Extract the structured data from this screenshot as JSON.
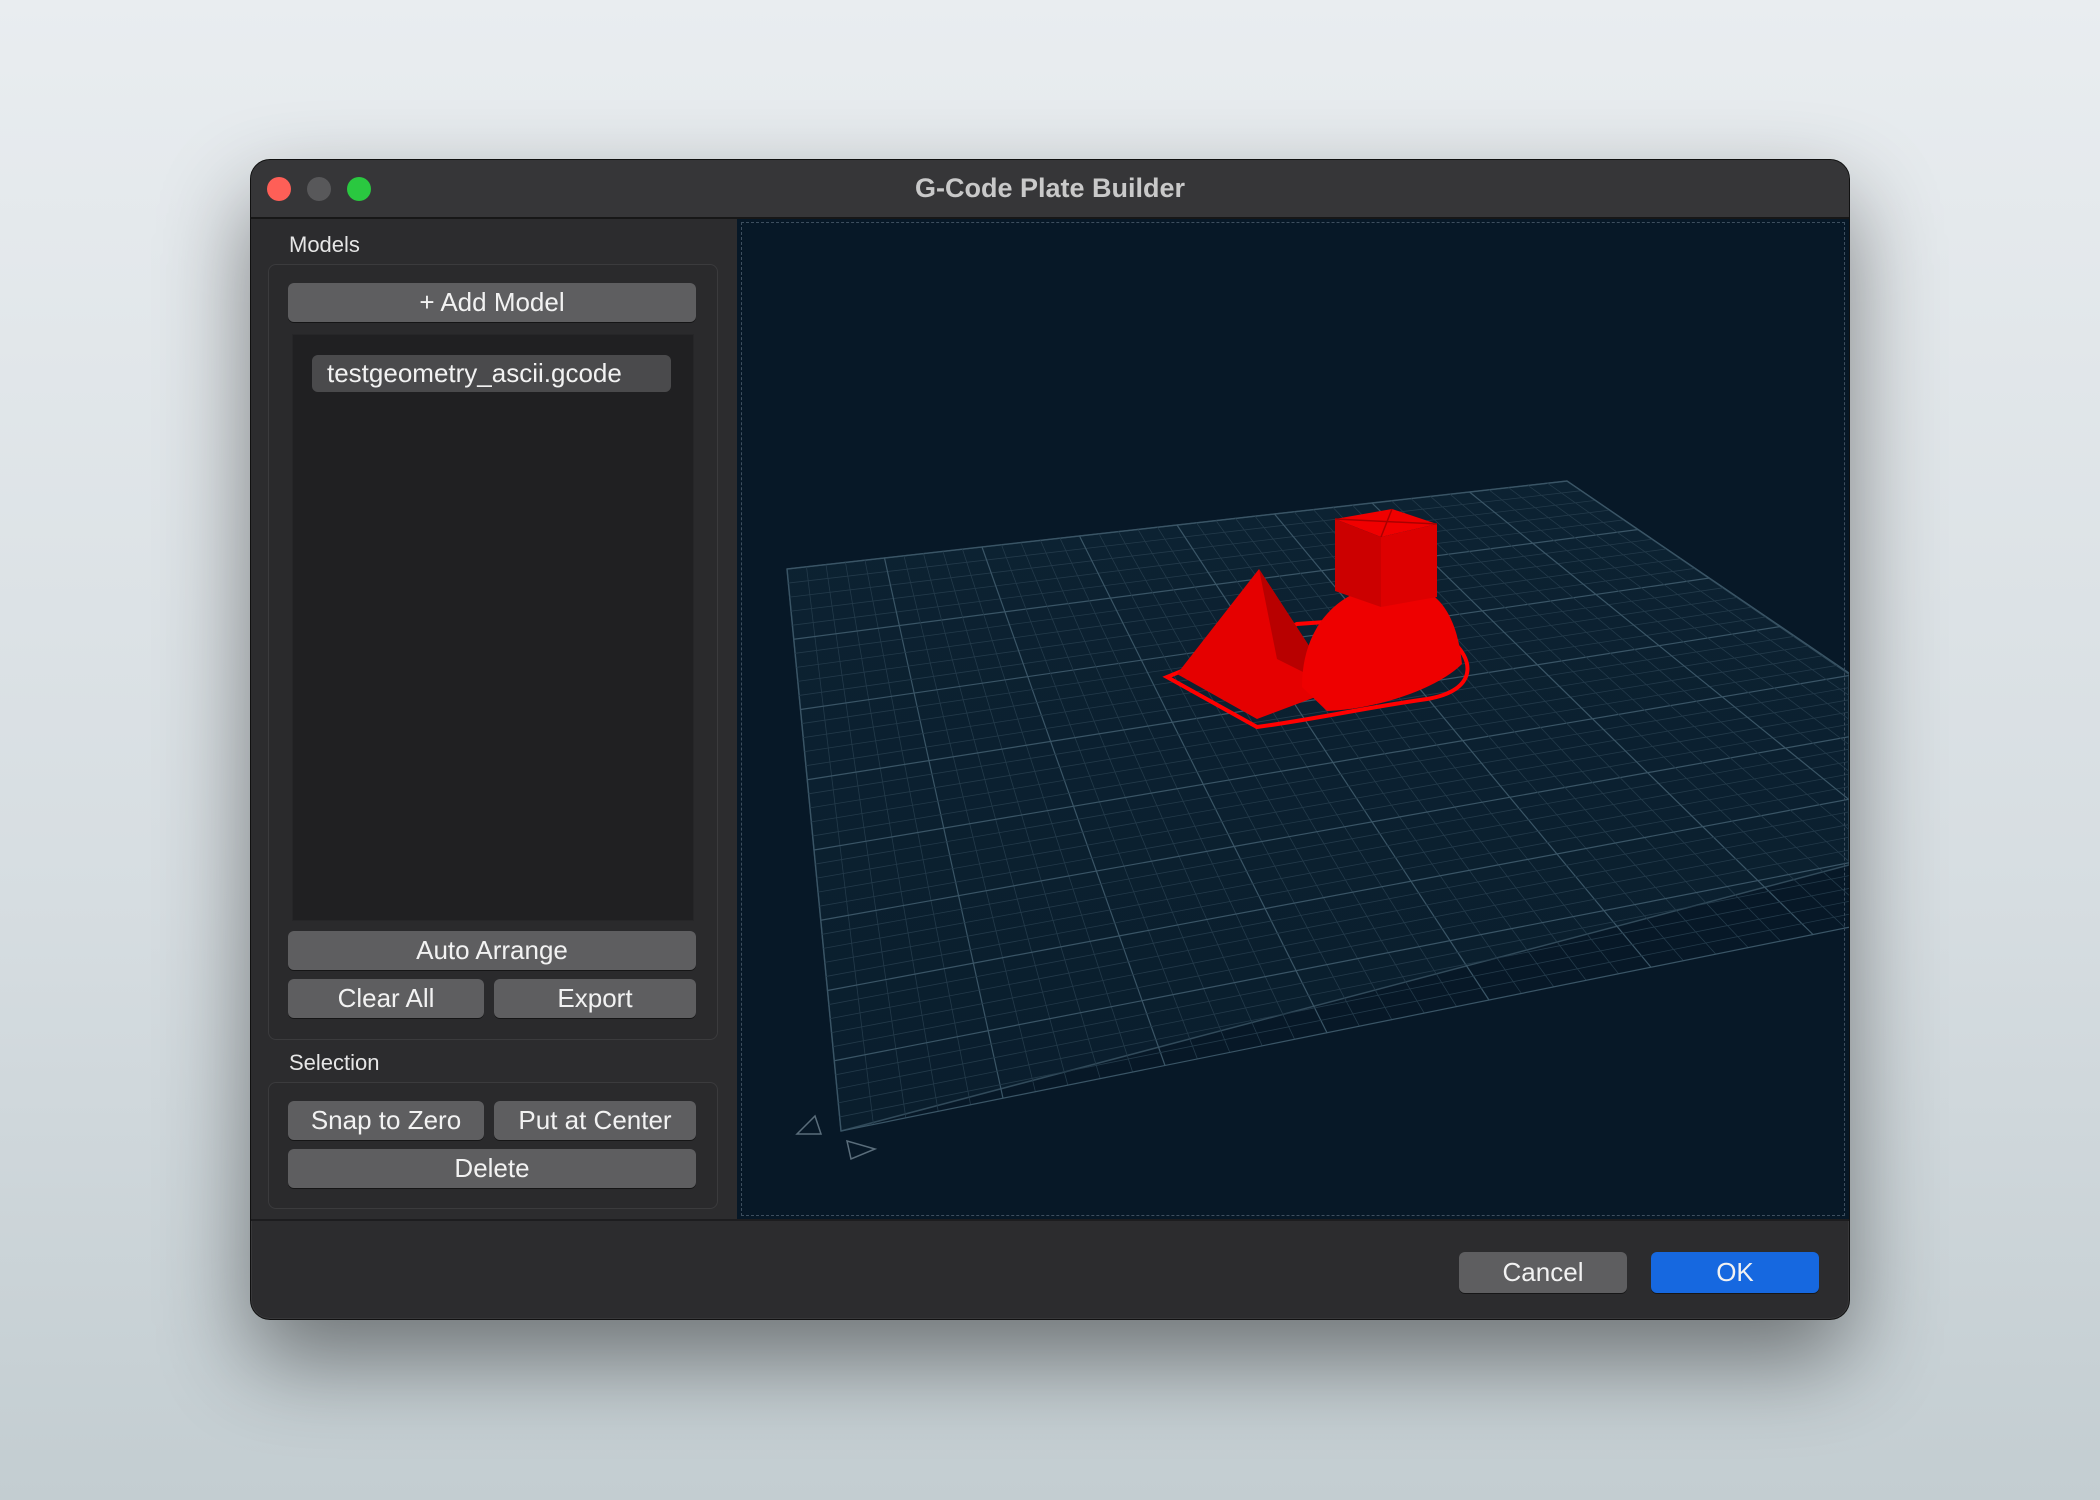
{
  "window": {
    "title": "G-Code Plate Builder"
  },
  "models": {
    "group_label": "Models",
    "add_label": "+ Add Model",
    "items": [
      "testgeometry_ascii.gcode"
    ],
    "auto_arrange_label": "Auto Arrange",
    "clear_all_label": "Clear All",
    "export_label": "Export"
  },
  "selection": {
    "group_label": "Selection",
    "snap_label": "Snap to Zero",
    "center_label": "Put at Center",
    "delete_label": "Delete"
  },
  "footer": {
    "cancel_label": "Cancel",
    "ok_label": "OK"
  },
  "colors": {
    "model": "#ff0000",
    "grid": "#3a5566",
    "viewport_bg": "#071827",
    "ok_button": "#1668e0",
    "close": "#fe5f57",
    "maximize": "#2ac840"
  }
}
